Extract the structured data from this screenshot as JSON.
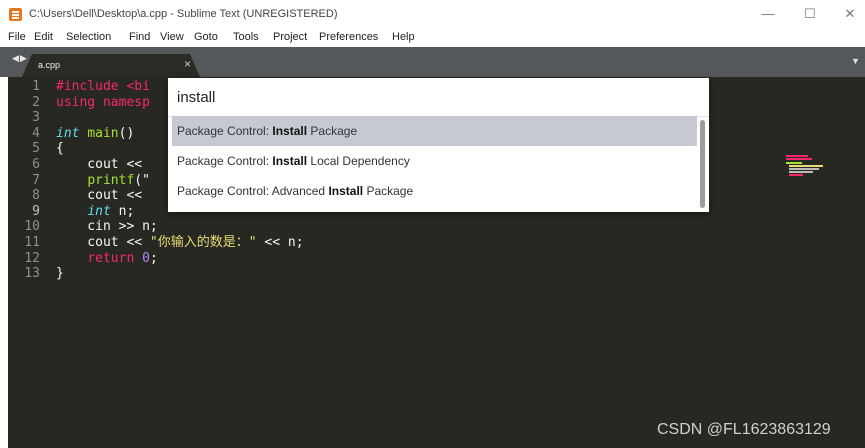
{
  "window": {
    "title": "C:\\Users\\Dell\\Desktop\\a.cpp - Sublime Text (UNREGISTERED)",
    "controls": [
      "minimize-icon",
      "maximize-icon",
      "close-icon"
    ]
  },
  "menu": {
    "items": [
      "File",
      "Edit",
      "Selection",
      "Find",
      "View",
      "Goto",
      "Tools",
      "Project",
      "Preferences",
      "Help"
    ]
  },
  "tabs": {
    "active": {
      "label": "a.cpp",
      "close": "×"
    }
  },
  "editor": {
    "line_numbers": [
      "1",
      "2",
      "3",
      "4",
      "5",
      "6",
      "7",
      "8",
      "9",
      "10",
      "11",
      "12",
      "13"
    ],
    "current_line": "9",
    "lines": [
      [
        {
          "t": "#include <bi",
          "c": "kw-pink"
        }
      ],
      [
        {
          "t": "using namesp",
          "c": "kw-pink"
        }
      ],
      [],
      [
        {
          "t": "int",
          "c": "kw-blue"
        },
        {
          "t": " "
        },
        {
          "t": "main",
          "c": "fn-green"
        },
        {
          "t": "()"
        }
      ],
      [
        {
          "t": "{"
        }
      ],
      [
        {
          "t": "    cout << "
        }
      ],
      [
        {
          "t": "    "
        },
        {
          "t": "printf",
          "c": "fn-green"
        },
        {
          "t": "(\""
        }
      ],
      [
        {
          "t": "    cout << "
        }
      ],
      [
        {
          "t": "    "
        },
        {
          "t": "int",
          "c": "kw-blue"
        },
        {
          "t": " n;"
        }
      ],
      [
        {
          "t": "    cin >> n;"
        }
      ],
      [
        {
          "t": "    cout << "
        },
        {
          "t": "\"你输入的数是：\"",
          "c": "str-yellow"
        },
        {
          "t": " << n;"
        }
      ],
      [
        {
          "t": "    "
        },
        {
          "t": "return",
          "c": "kw-pink"
        },
        {
          "t": " "
        },
        {
          "t": "0",
          "c": "num-purple"
        },
        {
          "t": ";"
        }
      ],
      [
        {
          "t": "}"
        }
      ]
    ]
  },
  "command_palette": {
    "input_value": "install",
    "results": [
      {
        "prefix": "Package Control: ",
        "bold": "Install",
        "suffix": " Package",
        "selected": true
      },
      {
        "prefix": "Package Control: ",
        "bold": "Install",
        "suffix": " Local Dependency",
        "selected": false
      },
      {
        "prefix": "Package Control: Advanced ",
        "bold": "Install",
        "suffix": " Package",
        "selected": false
      }
    ]
  },
  "watermark": "CSDN @FL1623863129",
  "colors": {
    "editor_bg": "#272822",
    "tab_bar": "#55585b",
    "selection_row": "#c6c9d2",
    "keyword": "#f92672",
    "type": "#66d9ef",
    "function": "#a6e22e",
    "string": "#e6db74",
    "number": "#ae81ff"
  }
}
